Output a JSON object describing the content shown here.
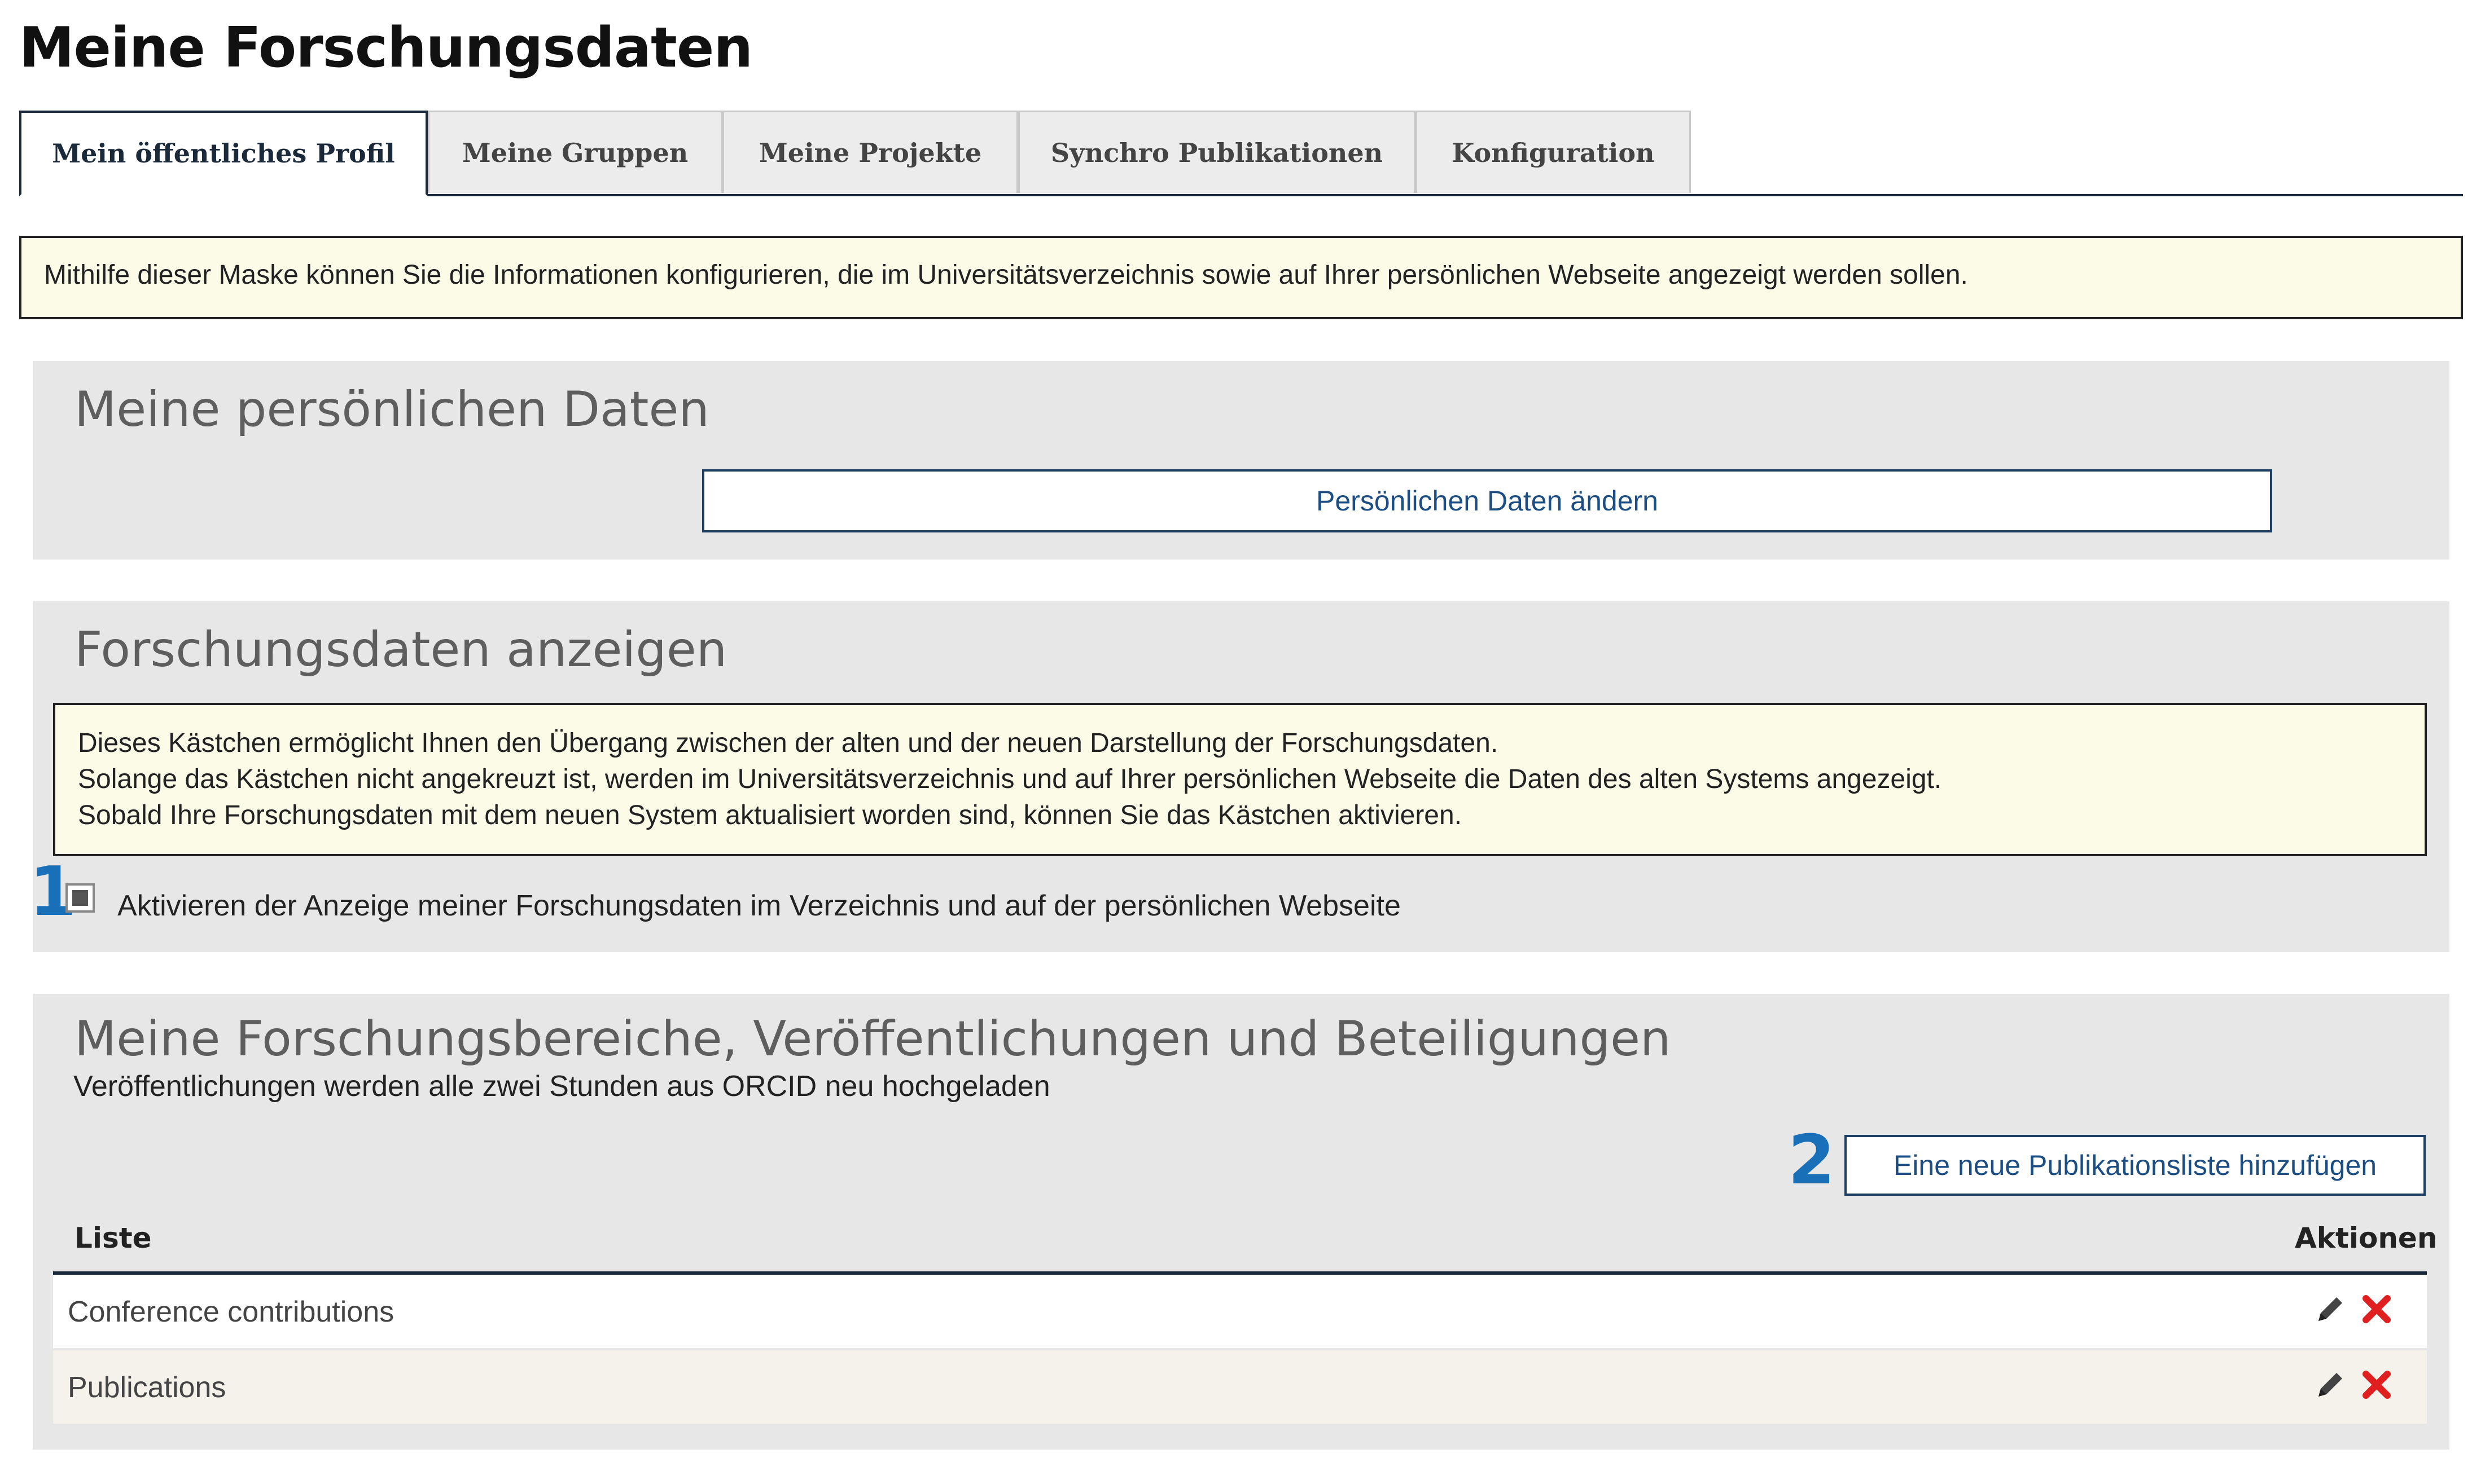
{
  "page": {
    "title": "Meine Forschungsdaten"
  },
  "tabs": [
    {
      "label": "Mein öffentliches Profil",
      "active": true
    },
    {
      "label": "Meine Gruppen"
    },
    {
      "label": "Meine Projekte"
    },
    {
      "label": "Synchro Publikationen"
    },
    {
      "label": "Konfiguration"
    }
  ],
  "top_info": "Mithilfe dieser Maske können Sie die Informationen konfigurieren, die im Universitätsverzeichnis sowie auf Ihrer persönlichen Webseite angezeigt werden sollen.",
  "personal": {
    "title": "Meine persönlichen Daten",
    "button": "Persönlichen Daten ändern"
  },
  "research_display": {
    "title": "Forschungsdaten anzeigen",
    "info_lines": [
      "Dieses Kästchen ermöglicht Ihnen den Übergang zwischen der alten und der neuen Darstellung der Forschungsdaten.",
      "Solange das Kästchen nicht angekreuzt ist, werden im Universitätsverzeichnis und auf Ihrer persönlichen Webseite die Daten des alten Systems angezeigt.",
      "Sobald Ihre Forschungsdaten mit dem neuen System aktualisiert worden sind, können Sie das Kästchen aktivieren."
    ],
    "checkbox_label": "Aktivieren der Anzeige meiner Forschungsdaten im Verzeichnis und auf der persönlichen Webseite",
    "marker": "1"
  },
  "areas": {
    "title": "Meine Forschungsbereiche, Veröffentlichungen und Beteiligungen",
    "subtitle": "Veröffentlichungen werden alle zwei Stunden aus ORCID neu hochgeladen",
    "add_button": "Eine neue Publikationsliste hinzufügen",
    "marker": "2",
    "col_list": "Liste",
    "col_actions": "Aktionen",
    "rows": [
      {
        "label": "Conference contributions"
      },
      {
        "label": "Publications"
      }
    ]
  },
  "colors": {
    "accent": "#1a70b8",
    "delete": "#e02020",
    "info_bg": "#fbfbe8",
    "panel_bg": "#e7e7e7"
  },
  "icons": {
    "edit": "pencil-icon",
    "delete": "delete-x-icon"
  }
}
